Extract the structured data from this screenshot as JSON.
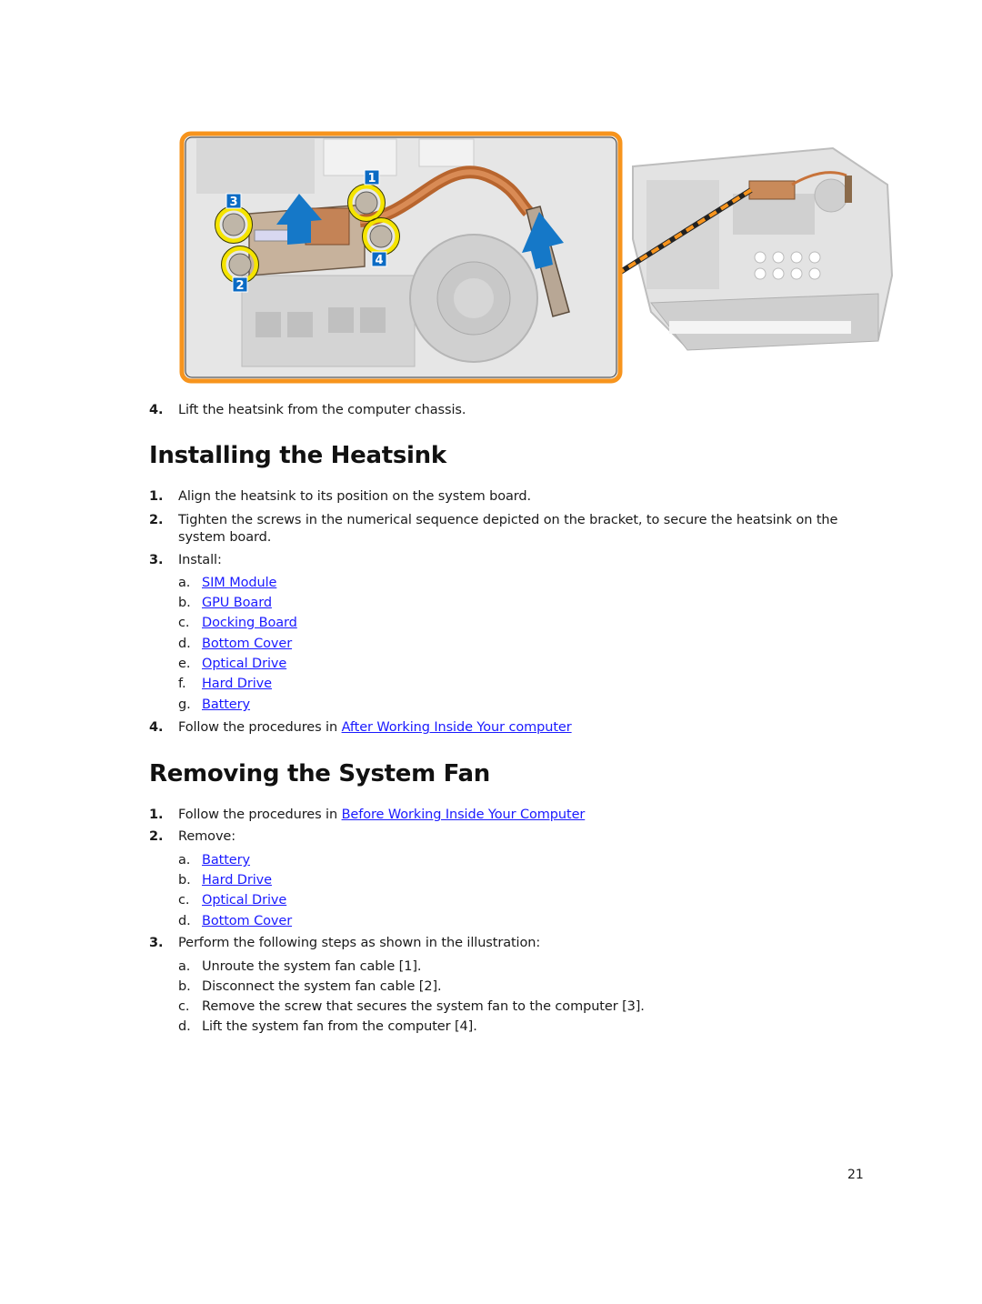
{
  "figure": {
    "callouts": [
      "1",
      "2",
      "3",
      "4"
    ],
    "colors": {
      "frame": "#f7941d",
      "callout_bg": "#0b6bc4",
      "ring": "#f5e400",
      "arrow": "#1578c8",
      "copper": "#c8733a"
    }
  },
  "removal_last_step": {
    "num": "4.",
    "text": "Lift the heatsink from the computer chassis."
  },
  "install": {
    "title": "Installing the Heatsink",
    "steps": [
      {
        "num": "1.",
        "text": "Align the heatsink to its position on the system board."
      },
      {
        "num": "2.",
        "text": "Tighten the screws in the numerical sequence depicted on the bracket, to secure the heatsink on the",
        "text2": "system board."
      },
      {
        "num": "3.",
        "text": "Install:"
      },
      {
        "num": "4.",
        "text": "Follow the procedures in ",
        "link": "After Working Inside Your computer"
      }
    ],
    "install_items": [
      {
        "letter": "a.",
        "label": "SIM Module"
      },
      {
        "letter": "b.",
        "label": "GPU Board"
      },
      {
        "letter": "c.",
        "label": "Docking Board"
      },
      {
        "letter": "d.",
        "label": "Bottom Cover"
      },
      {
        "letter": "e.",
        "label": "Optical Drive"
      },
      {
        "letter": "f.",
        "label": "Hard Drive"
      },
      {
        "letter": "g.",
        "label": "Battery"
      }
    ]
  },
  "fan": {
    "title": "Removing the System Fan",
    "steps": [
      {
        "num": "1.",
        "text": "Follow the procedures in ",
        "link": "Before Working Inside Your Computer"
      },
      {
        "num": "2.",
        "text": "Remove:"
      },
      {
        "num": "3.",
        "text": "Perform the following steps as shown in the illustration:"
      }
    ],
    "remove_items": [
      {
        "letter": "a.",
        "label": "Battery"
      },
      {
        "letter": "b.",
        "label": "Hard Drive"
      },
      {
        "letter": "c.",
        "label": "Optical Drive"
      },
      {
        "letter": "d.",
        "label": "Bottom Cover"
      }
    ],
    "substeps": [
      {
        "letter": "a.",
        "text": "Unroute the system fan cable [1]."
      },
      {
        "letter": "b.",
        "text": "Disconnect the system fan cable [2]."
      },
      {
        "letter": "c.",
        "text": "Remove the screw that secures the system fan to the computer [3]."
      },
      {
        "letter": "d.",
        "text": "Lift the system fan from the computer [4]."
      }
    ]
  },
  "page_number": "21"
}
